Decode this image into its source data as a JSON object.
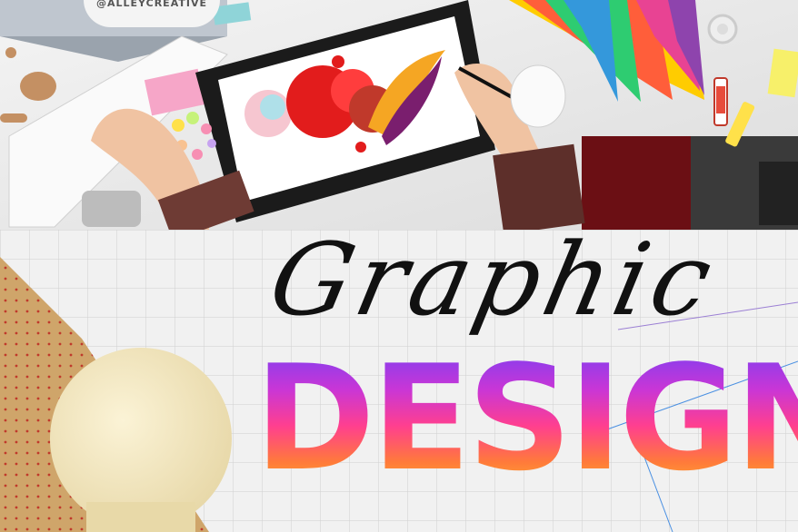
{
  "badge": {
    "text": "@ALLEYCREATIVE"
  },
  "poster": {
    "script_title": "Graphic",
    "block_title": "DESIGN"
  },
  "colors": {
    "design_gradient": [
      "#7b3ff2",
      "#c936d6",
      "#ff3f8f",
      "#ff7a3a",
      "#ffb02e"
    ],
    "kraft_paper": "#cfa56a",
    "bulb": "#f3e7c0"
  },
  "icons": [
    "tablet-icon",
    "keyboard-icon",
    "mouse-icon",
    "color-swatch-fan-icon",
    "paint-tube-icon",
    "light-bulb-icon"
  ]
}
